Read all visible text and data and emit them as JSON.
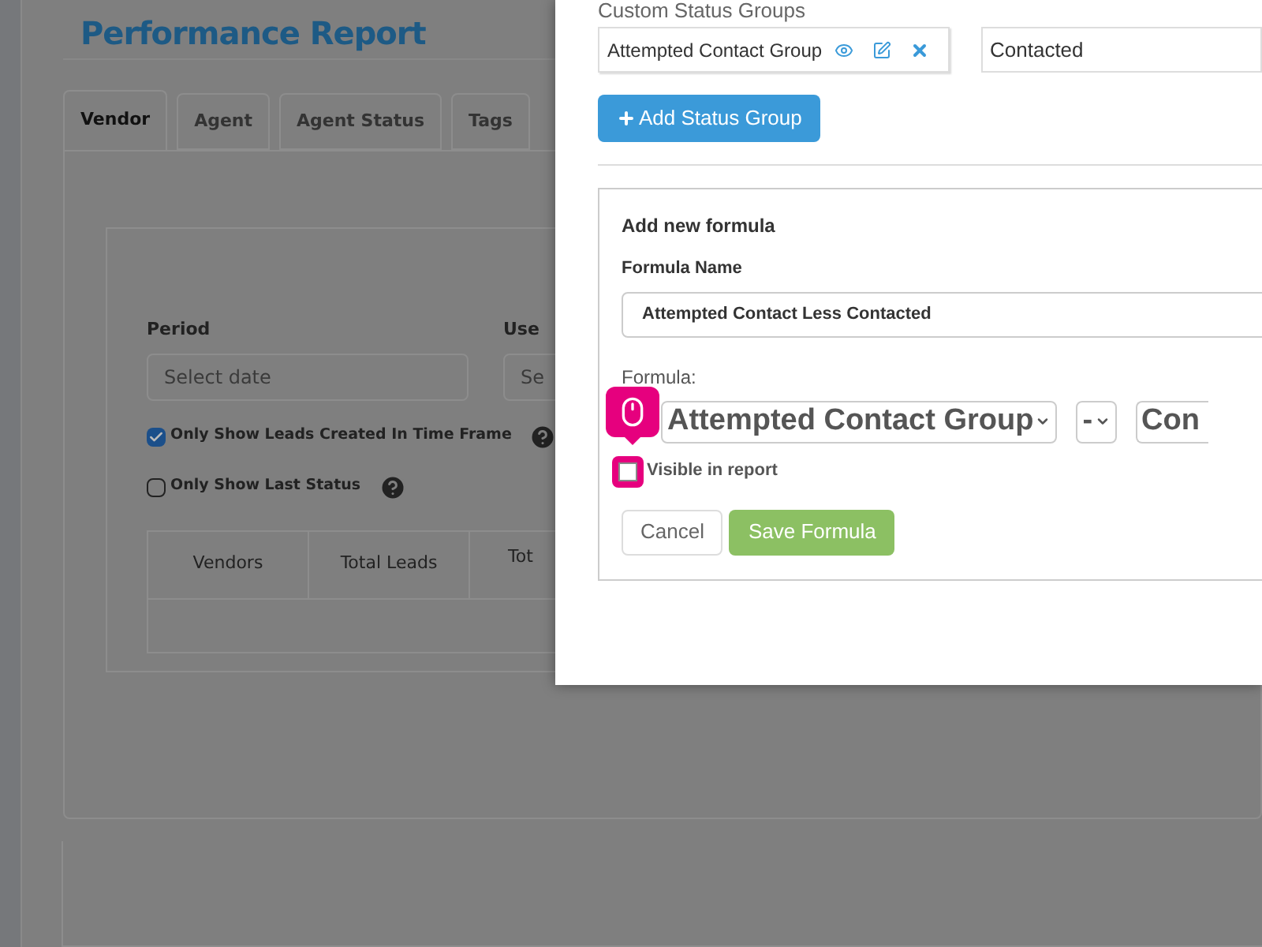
{
  "page": {
    "title": "Performance Report",
    "tabs": [
      {
        "label": "Vendor",
        "selected": true
      },
      {
        "label": "Agent",
        "selected": false
      },
      {
        "label": "Agent Status",
        "selected": false
      },
      {
        "label": "Tags",
        "selected": false
      }
    ],
    "filters": [
      {
        "label": "Period",
        "placeholder": "Select date"
      },
      {
        "label": "Use",
        "placeholder": "Se"
      }
    ],
    "options": [
      {
        "label": "Only Show Leads Created In Time Frame",
        "checked": true
      },
      {
        "label": "Only Show Last Status",
        "checked": false
      }
    ],
    "table": {
      "columns": [
        "Vendors",
        "Total Leads",
        "Tot"
      ]
    }
  },
  "modal": {
    "section_label": "Custom Status Groups",
    "groups": [
      "Attempted Contact Group",
      "Contacted"
    ],
    "add_button": "Add Status Group",
    "formula_panel": {
      "title": "Add new formula",
      "name_label": "Formula Name",
      "name_value": "Attempted Contact Less Contacted",
      "formula_label": "Formula:",
      "selects": [
        "Attempted Contact Group",
        "-",
        "Con"
      ],
      "visible": {
        "label": "Visible in report",
        "checked": false
      },
      "buttons": [
        "Cancel",
        "Save Formula"
      ]
    }
  }
}
